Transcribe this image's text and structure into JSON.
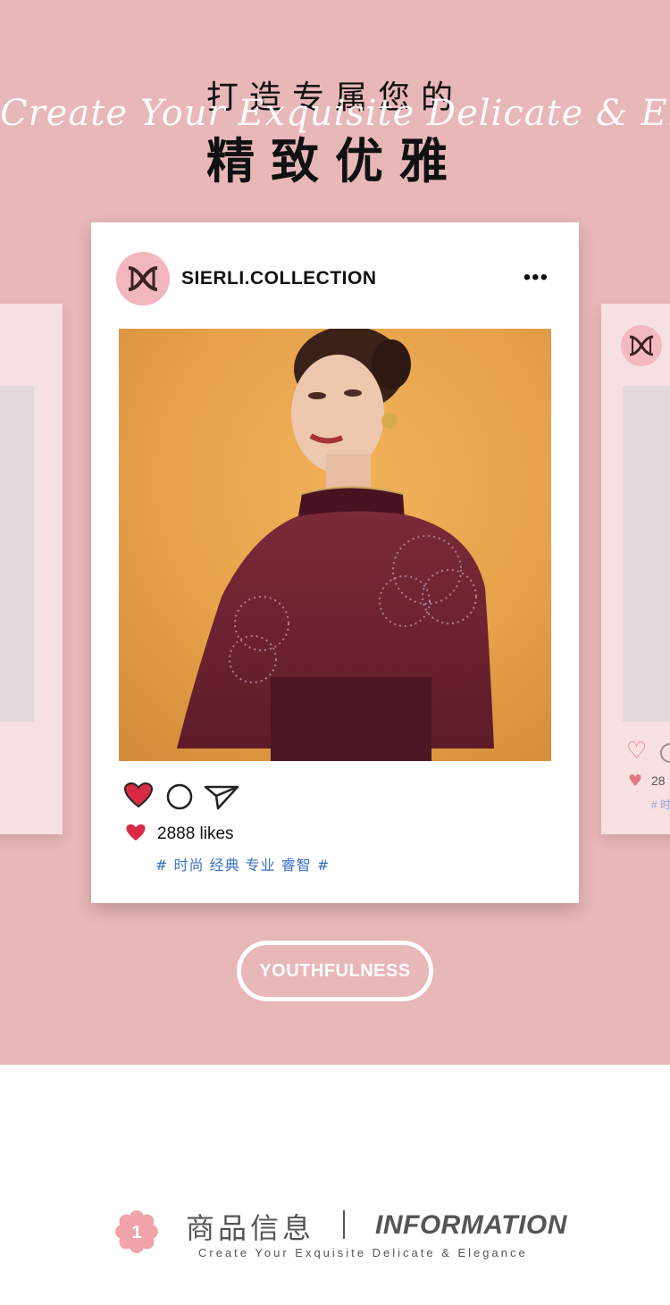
{
  "hero": {
    "headline_line1": "打造专属您的",
    "script_text": "Create Your Exquisite Delicate & Elegance",
    "headline_line2": "精致优雅",
    "background_color": "#e8b7b8"
  },
  "post": {
    "username": "SIERLI.COLLECTION",
    "more_icon": "more-dots-icon",
    "more_label": "•••",
    "photo_alt": "model-in-burgundy-cape",
    "actions": {
      "like_icon": "heart-icon",
      "comment_icon": "comment-circle-icon",
      "share_icon": "send-paper-plane-icon"
    },
    "likes_text": "2888 likes",
    "tags_text": "# 时尚 经典 专业 睿智 #",
    "heart_color": "#d82a44",
    "tag_color": "#3a6fc0"
  },
  "side_card_right": {
    "likes_partial": "28",
    "tags_partial": "# 时"
  },
  "badge": {
    "label": "YOUTHFULNESS"
  },
  "section": {
    "number": "1",
    "title_cn": "商品信息",
    "title_en": "INFORMATION",
    "subtitle": "Create Your Exquisite Delicate & Elegance"
  }
}
